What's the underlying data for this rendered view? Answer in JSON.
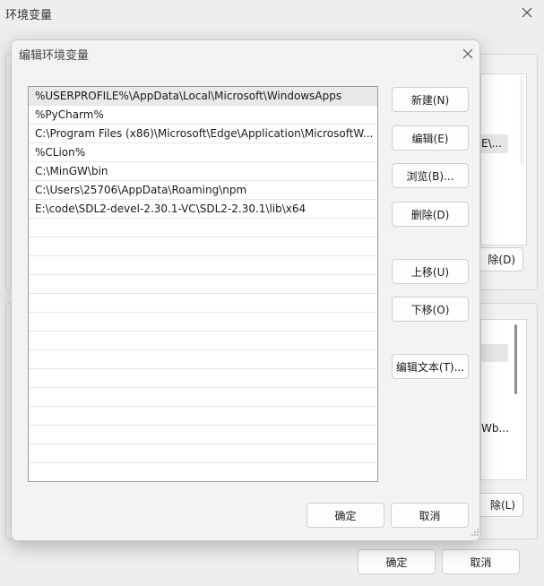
{
  "window": {
    "title": "环境变量"
  },
  "background": {
    "user_delete_fragment": "除(D)",
    "system_item_fragment_1": "E\\...",
    "system_item_fragment_2": "Wb...",
    "system_delete_fragment": "除(L)",
    "ok_label": "确定",
    "cancel_label": "取消"
  },
  "dialog": {
    "title": "编辑环境变量",
    "entries": [
      "%USERPROFILE%\\AppData\\Local\\Microsoft\\WindowsApps",
      "%PyCharm%",
      "C:\\Program Files (x86)\\Microsoft\\Edge\\Application\\MicrosoftW...",
      "%CLion%",
      "C:\\MinGW\\bin",
      "C:\\Users\\25706\\AppData\\Roaming\\npm",
      "E:\\code\\SDL2-devel-2.30.1-VC\\SDL2-2.30.1\\lib\\x64"
    ],
    "buttons": {
      "new": "新建(N)",
      "edit": "编辑(E)",
      "browse": "浏览(B)...",
      "delete": "删除(D)",
      "move_up": "上移(U)",
      "move_down": "下移(O)",
      "edit_text": "编辑文本(T)..."
    },
    "ok_label": "确定",
    "cancel_label": "取消"
  }
}
